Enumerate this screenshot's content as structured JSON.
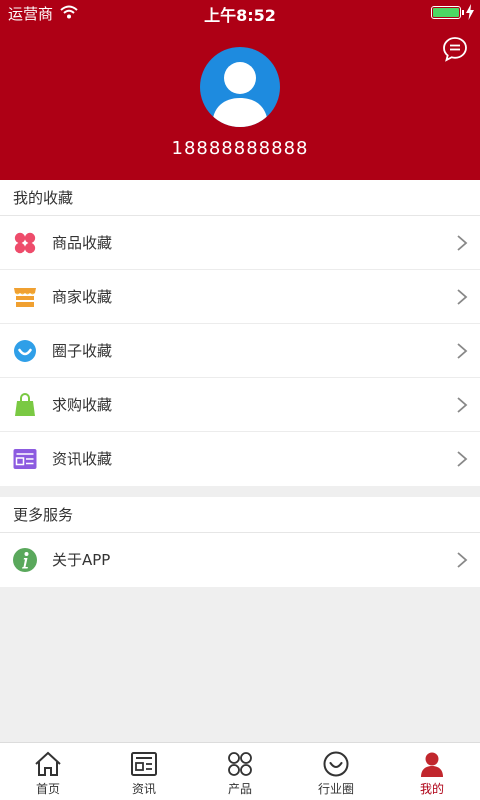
{
  "status_bar": {
    "carrier": "运营商",
    "time": "上午8:52",
    "battery_level": 1.0,
    "battery_color": "#4cd964"
  },
  "header": {
    "background": "#ae0015",
    "phone": "18888888888",
    "avatar_icon": "user-avatar-icon",
    "message_icon": "chat-bubble-icon"
  },
  "favorites": {
    "title": "我的收藏",
    "items": [
      {
        "label": "商品收藏",
        "icon": "four-petal-icon"
      },
      {
        "label": "商家收藏",
        "icon": "shop-icon"
      },
      {
        "label": "圈子收藏",
        "icon": "smile-circle-icon"
      },
      {
        "label": "求购收藏",
        "icon": "shopping-bag-icon"
      },
      {
        "label": "资讯收藏",
        "icon": "news-card-icon"
      }
    ]
  },
  "services": {
    "title": "更多服务",
    "items": [
      {
        "label": "关于APP",
        "icon": "info-icon"
      }
    ]
  },
  "tabbar": {
    "active_index": 4,
    "active_color": "#ae0015",
    "tabs": [
      {
        "label": "首页",
        "icon": "home-icon"
      },
      {
        "label": "资讯",
        "icon": "news-icon"
      },
      {
        "label": "产品",
        "icon": "product-grid-icon"
      },
      {
        "label": "行业圈",
        "icon": "circle-smile-icon"
      },
      {
        "label": "我的",
        "icon": "user-icon"
      }
    ]
  }
}
